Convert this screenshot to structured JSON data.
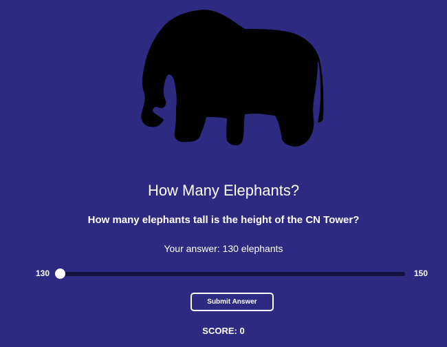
{
  "image": {
    "icon": "elephant-silhouette",
    "color": "#000000"
  },
  "quiz": {
    "title": "How Many Elephants?",
    "question": "How many elephants tall is the height of the CN Tower?",
    "answer_label": "Your answer: 130 elephants"
  },
  "slider": {
    "min_label": "130",
    "max_label": "150",
    "min": 130,
    "max": 150,
    "value": 130
  },
  "submit": {
    "label": "Submit Answer"
  },
  "score": {
    "label": "SCORE: 0"
  },
  "colors": {
    "background": "#2d2a82",
    "track": "#12113f",
    "text": "#ffffff"
  }
}
